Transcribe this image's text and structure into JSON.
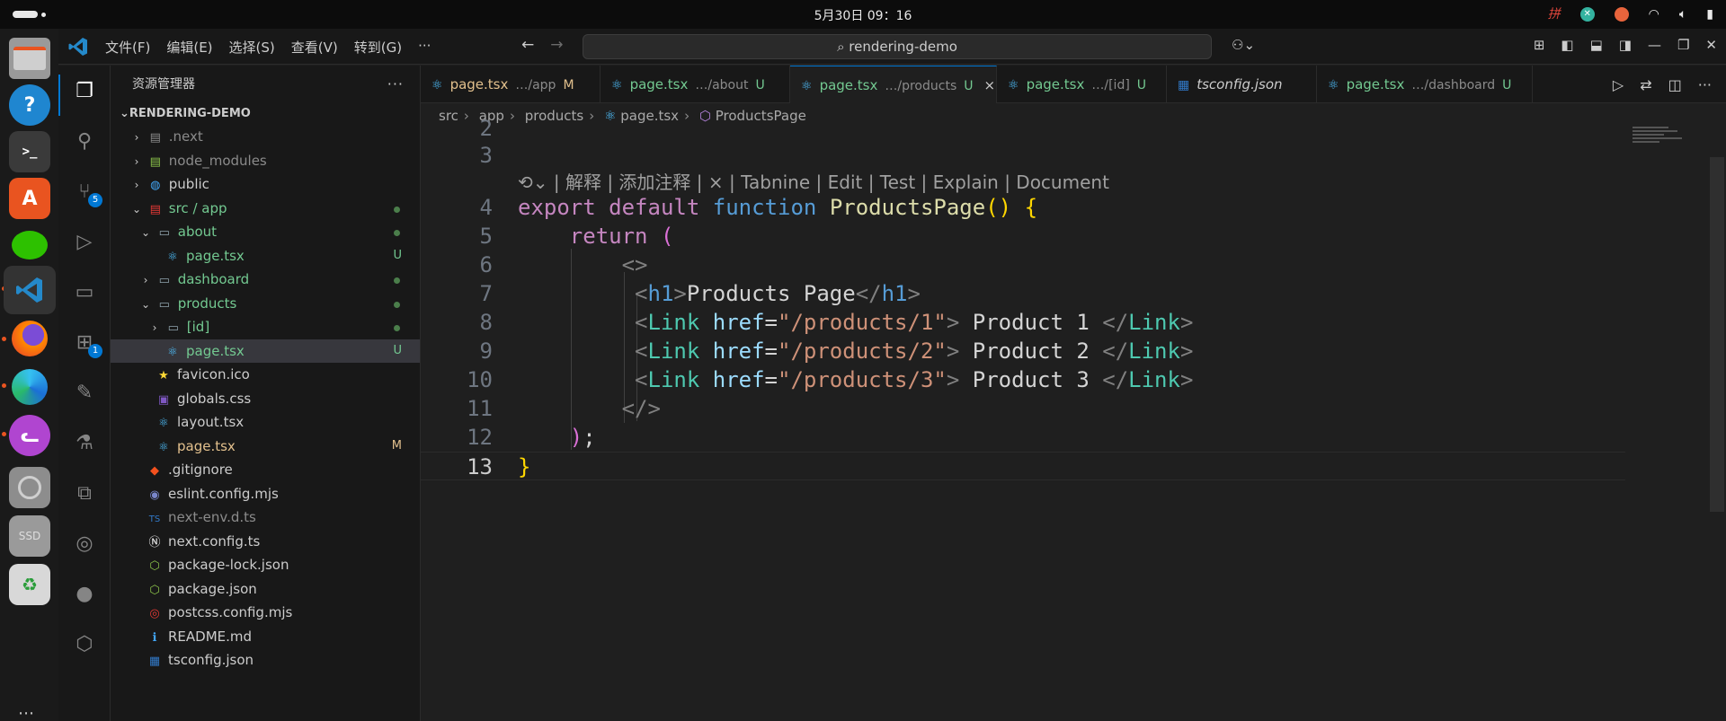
{
  "system": {
    "clock": "5月30日  09：16",
    "tray_icons": [
      "input-method-icon",
      "app-x-icon",
      "app-shield-icon",
      "wifi-icon",
      "volume-icon",
      "battery-icon"
    ]
  },
  "dock": {
    "apps": [
      "files",
      "help",
      "terminal",
      "app-center",
      "wechat",
      "vscode",
      "firefox",
      "edge",
      "cat-app",
      "disk",
      "ssd",
      "trash"
    ],
    "ssd_label": "SSD"
  },
  "titlebar": {
    "menu": [
      "文件(F)",
      "编辑(E)",
      "选择(S)",
      "查看(V)",
      "转到(G)",
      "···"
    ],
    "search_text": "rendering-demo"
  },
  "activity": {
    "scm_badge": "5",
    "extensions_badge": "1"
  },
  "sidebar": {
    "title": "资源管理器",
    "more": "···",
    "root": "RENDERING-DEMO",
    "rows": [
      {
        "label": ".next",
        "status": ""
      },
      {
        "label": "node_modules",
        "status": ""
      },
      {
        "label": "public",
        "status": ""
      },
      {
        "label": "src / app",
        "status": ""
      },
      {
        "label": "about",
        "status": ""
      },
      {
        "label": "page.tsx",
        "status": "U"
      },
      {
        "label": "dashboard",
        "status": ""
      },
      {
        "label": "products",
        "status": ""
      },
      {
        "label": "[id]",
        "status": ""
      },
      {
        "label": "page.tsx",
        "status": "U"
      },
      {
        "label": "favicon.ico",
        "status": ""
      },
      {
        "label": "globals.css",
        "status": ""
      },
      {
        "label": "layout.tsx",
        "status": ""
      },
      {
        "label": "page.tsx",
        "status": "M"
      },
      {
        "label": ".gitignore",
        "status": ""
      },
      {
        "label": "eslint.config.mjs",
        "status": ""
      },
      {
        "label": "next-env.d.ts",
        "status": ""
      },
      {
        "label": "next.config.ts",
        "status": ""
      },
      {
        "label": "package-lock.json",
        "status": ""
      },
      {
        "label": "package.json",
        "status": ""
      },
      {
        "label": "postcss.config.mjs",
        "status": ""
      },
      {
        "label": "README.md",
        "status": ""
      },
      {
        "label": "tsconfig.json",
        "status": ""
      }
    ]
  },
  "tabs": [
    {
      "name": "page.tsx",
      "path": "…/app",
      "status": "M"
    },
    {
      "name": "page.tsx",
      "path": "…/about",
      "status": "U"
    },
    {
      "name": "page.tsx",
      "path": "…/products",
      "status": "U",
      "close": "×"
    },
    {
      "name": "page.tsx",
      "path": "…/[id]",
      "status": "U"
    },
    {
      "name": "tsconfig.json",
      "path": "",
      "status": ""
    },
    {
      "name": "page.tsx",
      "path": "…/dashboard",
      "status": "U"
    }
  ],
  "breadcrumb": [
    "src",
    "app",
    "products",
    "page.tsx",
    "ProductsPage"
  ],
  "editor": {
    "line_numbers": [
      "2",
      "3",
      "4",
      "5",
      "6",
      "7",
      "8",
      "9",
      "10",
      "11",
      "12",
      "13"
    ],
    "codelens": "| 解释 | 添加注释 | × | Tabnine | Edit | Test | Explain | Document",
    "code": {
      "l4_export": "export",
      "l4_default": "default",
      "l4_function": "function",
      "l4_name": "ProductsPage",
      "l4_parens": "()",
      "l4_brace": "{",
      "l5_return": "return",
      "l5_paren": "(",
      "l6_frag": "<>",
      "l7_open": "<",
      "l7_tag": "h1",
      "l7_close": ">",
      "l7_text": "Products Page",
      "l7_end_open": "</",
      "l7_end_tag": "h1",
      "l7_end_close": ">",
      "link_tag": "Link",
      "href_attr": "href",
      "eq": "=",
      "href1": "\"/products/1\"",
      "href2": "\"/products/2\"",
      "href3": "\"/products/3\"",
      "text1": " Product 1 ",
      "text2": " Product 2 ",
      "text3": " Product 3 ",
      "l11_frag": "</>",
      "l12_paren": ")",
      "l12_semi": ";",
      "l13_brace": "}"
    }
  }
}
